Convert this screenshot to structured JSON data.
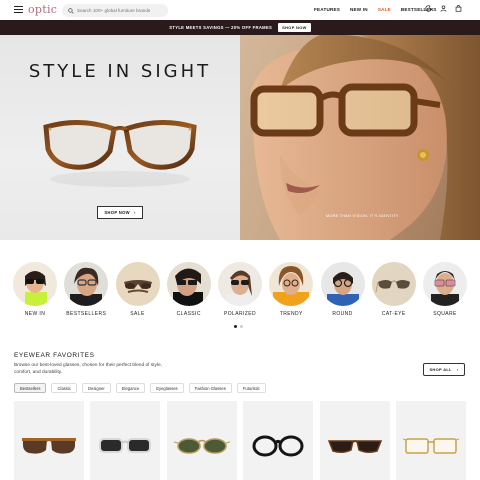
{
  "header": {
    "logo": "optic",
    "search_placeholder": "Search 100+ global furniture brands",
    "nav": [
      "FEATURES",
      "NEW IN",
      "SALE",
      "BESTSELLERS"
    ]
  },
  "promo": {
    "text": "STYLE MEETS SAVINGS — 20% OFF FRAMES",
    "button": "SHOP NOW"
  },
  "hero": {
    "title": "STYLE IN SIGHT",
    "button": "SHOP NOW",
    "caption": "MORE THAN VISION, IT'S IDENTITY"
  },
  "categories": [
    "NEW IN",
    "BESTSELLERS",
    "SALE",
    "CLASSIC",
    "POLARIZED",
    "TRENDY",
    "ROUND",
    "CAT-EYE",
    "SQUARE"
  ],
  "favorites": {
    "title": "EYEWEAR FAVORITES",
    "description": "Browse our best-loved glasses, chosen for their perfect blend of style, comfort, and durability.",
    "shop_all": "SHOP ALL",
    "tabs": [
      "Bestsellers",
      "Classic",
      "Designer",
      "Elegance",
      "Eyeglasses",
      "Fashion Glasses",
      "Futuristic"
    ],
    "active_tab": "Bestsellers"
  },
  "colors": {
    "promo_bg": "#2a1a1c",
    "sale": "#e0522f",
    "logo": "#b06a7a"
  }
}
